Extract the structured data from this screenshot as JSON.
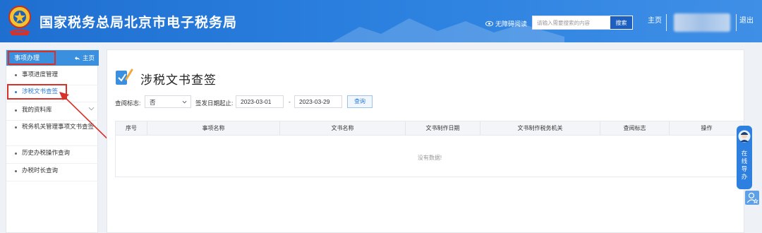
{
  "header": {
    "site_title": "国家税务总局北京市电子税务局",
    "accessibility": "无障碍阅读",
    "search_placeholder": "请输入需要搜索的内容",
    "search_button": "搜索",
    "home": "主页",
    "logout": "退出"
  },
  "sidebar": {
    "title": "事项办理",
    "home": "主页",
    "items": [
      {
        "label": "事项进度管理"
      },
      {
        "label": "涉税文书查签"
      },
      {
        "label": "我的资料库"
      },
      {
        "label": "税务机关管理事项文书查签"
      },
      {
        "label": "历史办税操作查询"
      },
      {
        "label": "办税时长查询"
      }
    ]
  },
  "main": {
    "title": "涉税文书查签",
    "filter": {
      "review_label": "查阅标志:",
      "review_value": "否",
      "date_label": "签发日期起止:",
      "date_start": "2023-03-01",
      "date_separator": "-",
      "date_end": "2023-03-29",
      "query_button": "查询"
    },
    "table": {
      "columns": [
        "序号",
        "事项名称",
        "文书名称",
        "文书制作日期",
        "文书制作税务机关",
        "查阅标志",
        "操作"
      ],
      "empty_text": "没有数据!"
    }
  },
  "guide": {
    "text": [
      "在",
      "线",
      "导",
      "办"
    ]
  },
  "colors": {
    "header_blue": "#2d82e0",
    "annotation_red": "#d8312a",
    "link_blue": "#2979d6"
  }
}
